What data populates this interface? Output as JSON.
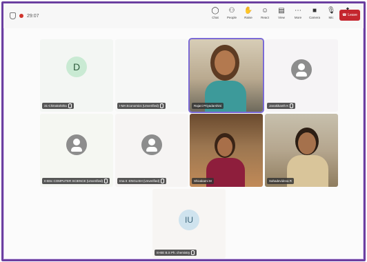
{
  "window": {
    "meeting_timer": "29:07"
  },
  "toolbar": {
    "tools": [
      {
        "label": "Chat",
        "icon": "chat-icon"
      },
      {
        "label": "People",
        "icon": "people-icon"
      },
      {
        "label": "Raise",
        "icon": "raise-hand-icon"
      },
      {
        "label": "React",
        "icon": "react-icon"
      },
      {
        "label": "View",
        "icon": "view-icon"
      },
      {
        "label": "More",
        "icon": "more-icon"
      },
      {
        "label": "Camera",
        "icon": "camera-icon"
      },
      {
        "label": "Mic",
        "icon": "mic-icon"
      },
      {
        "label": "Share",
        "icon": "share-icon"
      }
    ],
    "leave_label": "Leave"
  },
  "participants": [
    {
      "name": "31-Chitrakshitha",
      "avatar": "D"
    },
    {
      "name": "I-MA Economics (Unverified)"
    },
    {
      "name": "Rajani Priyadarshini"
    },
    {
      "name": "Janakikanth K"
    },
    {
      "name": "II-BSc COMPUTER SCIENCE (Unverified)"
    },
    {
      "name": "Ima II -ENGLISH (Unverified)"
    },
    {
      "name": "Shivakami M"
    },
    {
      "name": "Sahadevideva R"
    },
    {
      "name": "III-BE B.S Ph. chemistry",
      "avatar": "IU"
    }
  ],
  "colors": {
    "frame": "#6b3fa0",
    "leave_button": "#c4262e",
    "active_speaker_border": "#7b6ad6"
  }
}
